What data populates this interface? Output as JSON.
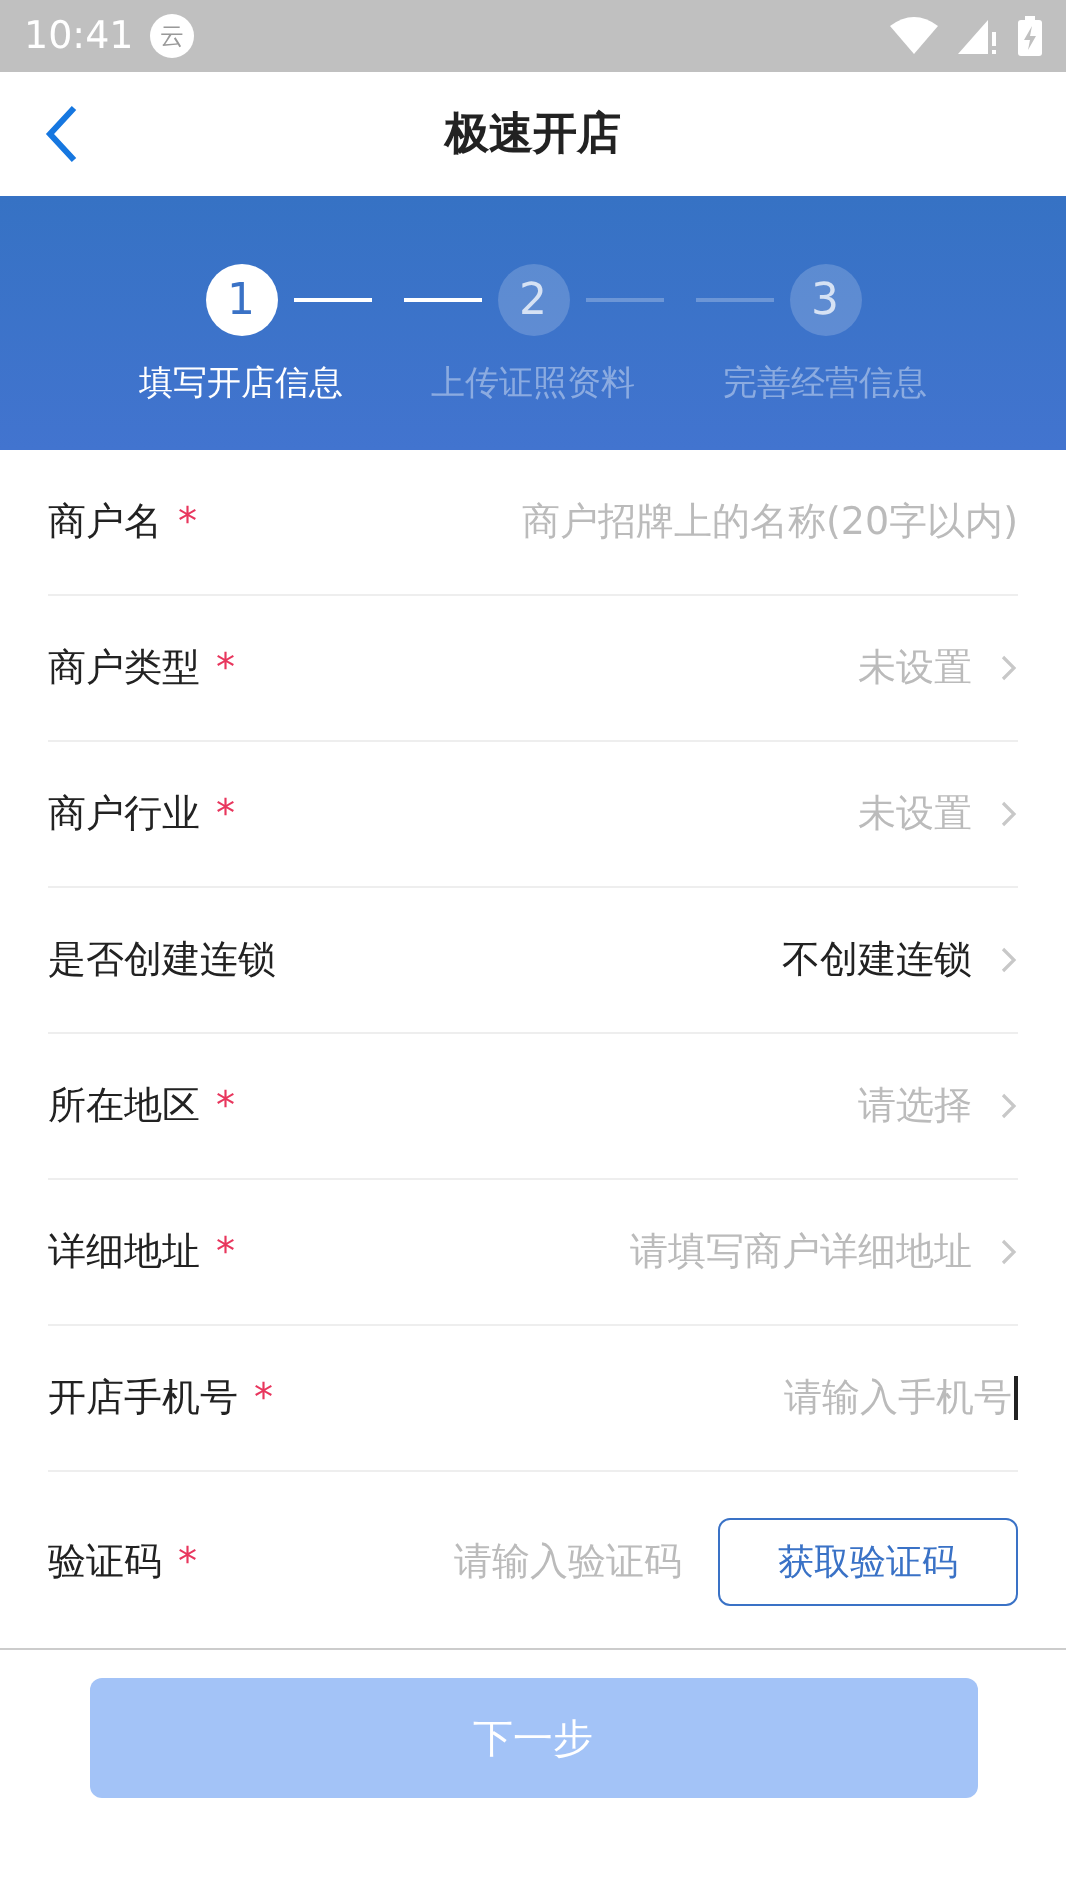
{
  "status_bar": {
    "time": "10:41",
    "notification": "云"
  },
  "header": {
    "title": "极速开店"
  },
  "steps": [
    {
      "number": "1",
      "label": "填写开店信息",
      "selected": true
    },
    {
      "number": "2",
      "label": "上传证照资料",
      "selected": false
    },
    {
      "number": "3",
      "label": "完善经营信息",
      "selected": false
    }
  ],
  "form": [
    {
      "kind": "input",
      "label": "商户名",
      "mark": "*",
      "placeholder": "商户招牌上的名称(20字以内)",
      "focused": false
    },
    {
      "kind": "select",
      "label": "商户类型",
      "mark": "*",
      "placeholder": "未设置"
    },
    {
      "kind": "select",
      "label": "商户行业",
      "mark": "*",
      "placeholder": "未设置"
    },
    {
      "kind": "select",
      "label": "是否创建连锁",
      "value": "不创建连锁"
    },
    {
      "kind": "select",
      "label": "所在地区",
      "mark": "*",
      "placeholder": "请选择"
    },
    {
      "kind": "select",
      "label": "详细地址",
      "mark": "*",
      "placeholder": "请填写商户详细地址"
    },
    {
      "kind": "input",
      "label": "开店手机号",
      "mark": "*",
      "placeholder": "请输入手机号",
      "focused": true
    },
    {
      "kind": "code",
      "label": "验证码",
      "mark": "*",
      "placeholder": "请输入验证码",
      "button": "获取验证码"
    }
  ],
  "next_button": {
    "label": "下一步",
    "disabled": true
  }
}
